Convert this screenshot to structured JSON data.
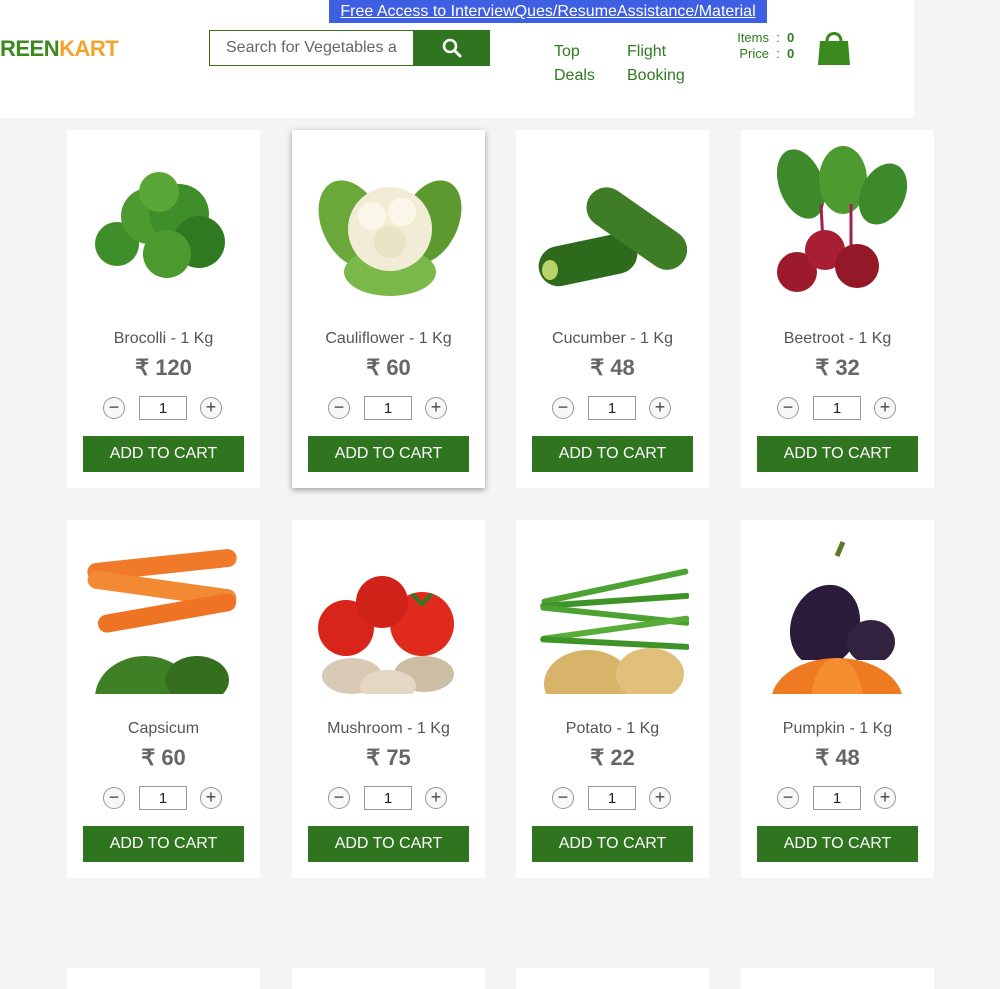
{
  "promo": {
    "text": "Free Access to InterviewQues/ResumeAssistance/Material"
  },
  "brand": {
    "green_part": "REEN",
    "orange_part": "KART"
  },
  "search": {
    "placeholder": "Search for Vegetables and Fruits",
    "button_icon": "search-icon"
  },
  "nav": {
    "top_deals": "Top\nDeals",
    "flight_booking": "Flight\nBooking"
  },
  "cart_summary": {
    "items_label": "Items",
    "items_value": "0",
    "price_label": "Price",
    "price_value": "0",
    "icon": "shopping-bag-icon"
  },
  "colors": {
    "brand_green": "#2f7520",
    "brand_orange": "#f3a52a",
    "promo_blue": "#3f5fe3"
  },
  "products": [
    {
      "name": "Brocolli - 1 Kg",
      "price": "₹ 120",
      "qty": "1",
      "button": "ADD TO CART",
      "image": "broccoli"
    },
    {
      "name": "Cauliflower - 1 Kg",
      "price": "₹ 60",
      "qty": "1",
      "button": "ADD TO CART",
      "image": "cauliflower"
    },
    {
      "name": "Cucumber - 1 Kg",
      "price": "₹ 48",
      "qty": "1",
      "button": "ADD TO CART",
      "image": "cucumber"
    },
    {
      "name": "Beetroot - 1 Kg",
      "price": "₹ 32",
      "qty": "1",
      "button": "ADD TO CART",
      "image": "beetroot"
    },
    {
      "name": "Capsicum",
      "price": "₹ 60",
      "qty": "1",
      "button": "ADD TO CART",
      "image": "carrot-capsicum"
    },
    {
      "name": "Mushroom - 1 Kg",
      "price": "₹ 75",
      "qty": "1",
      "button": "ADD TO CART",
      "image": "tomato-mushroom"
    },
    {
      "name": "Potato - 1 Kg",
      "price": "₹ 22",
      "qty": "1",
      "button": "ADD TO CART",
      "image": "beans-potato"
    },
    {
      "name": "Pumpkin - 1 Kg",
      "price": "₹ 48",
      "qty": "1",
      "button": "ADD TO CART",
      "image": "brinjal-pumpkin"
    }
  ]
}
